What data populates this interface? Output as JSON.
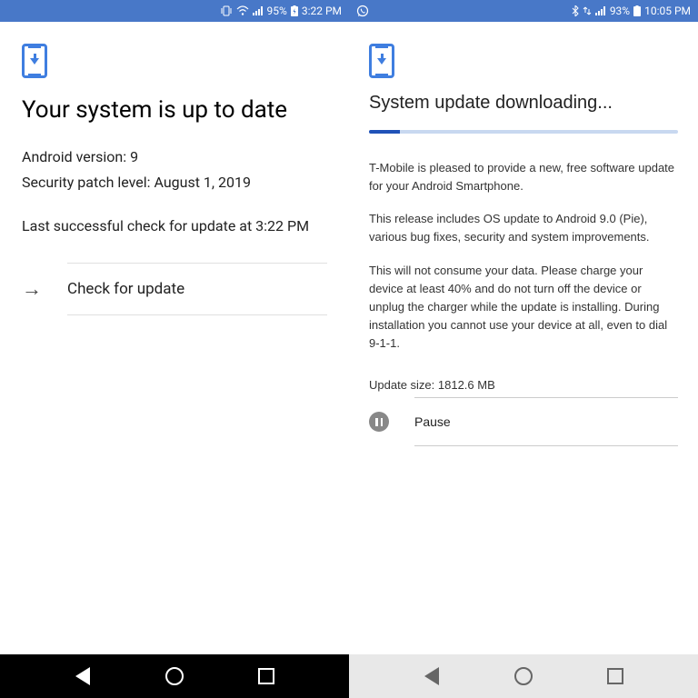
{
  "screen1": {
    "status": {
      "battery": "95%",
      "time": "3:22 PM"
    },
    "title": "Your system is up to date",
    "android_version_label": "Android version: 9",
    "security_patch_label": "Security patch level: August 1, 2019",
    "last_check": "Last successful check for update at 3:22 PM",
    "check_button": "Check for update"
  },
  "screen2": {
    "status": {
      "battery": "93%",
      "time": "10:05 PM"
    },
    "title": "System update downloading...",
    "progress_percent": 10,
    "para1": "T-Mobile is pleased to provide a new, free software update for your Android Smartphone.",
    "para2": "This release includes OS update to Android 9.0 (Pie), various bug fixes, security and system improvements.",
    "para3": "This will not consume your data. Please charge your device at least 40% and do not turn off the device or unplug the charger while the update is installing. During installation you cannot use your device at all, even to dial 9-1-1.",
    "update_size": "Update size: 1812.6 MB",
    "pause_button": "Pause"
  }
}
